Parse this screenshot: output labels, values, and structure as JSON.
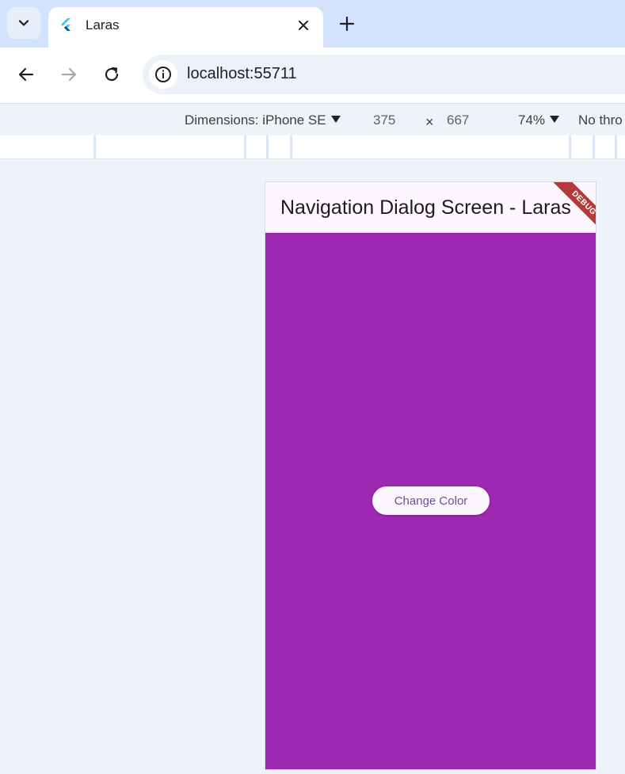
{
  "browser": {
    "tab": {
      "title": "Laras"
    },
    "omnibox": {
      "url": "localhost:55711"
    }
  },
  "devtools": {
    "dimensions_label": "Dimensions: iPhone SE",
    "width": "375",
    "times": "×",
    "height": "667",
    "zoom": "74%",
    "throttle": "No thro"
  },
  "app": {
    "title": "Navigation Dialog Screen - Laras",
    "debug_banner": "DEBUG",
    "button_label": "Change Color",
    "background_color": "#9c27b0"
  },
  "icons": {
    "tab_search": "chevron-down-icon",
    "favicon": "flutter-icon",
    "tab_close": "close-icon",
    "new_tab": "plus-icon",
    "back": "arrow-back-icon",
    "forward": "arrow-forward-icon",
    "reload": "reload-icon",
    "site_info": "info-icon"
  }
}
